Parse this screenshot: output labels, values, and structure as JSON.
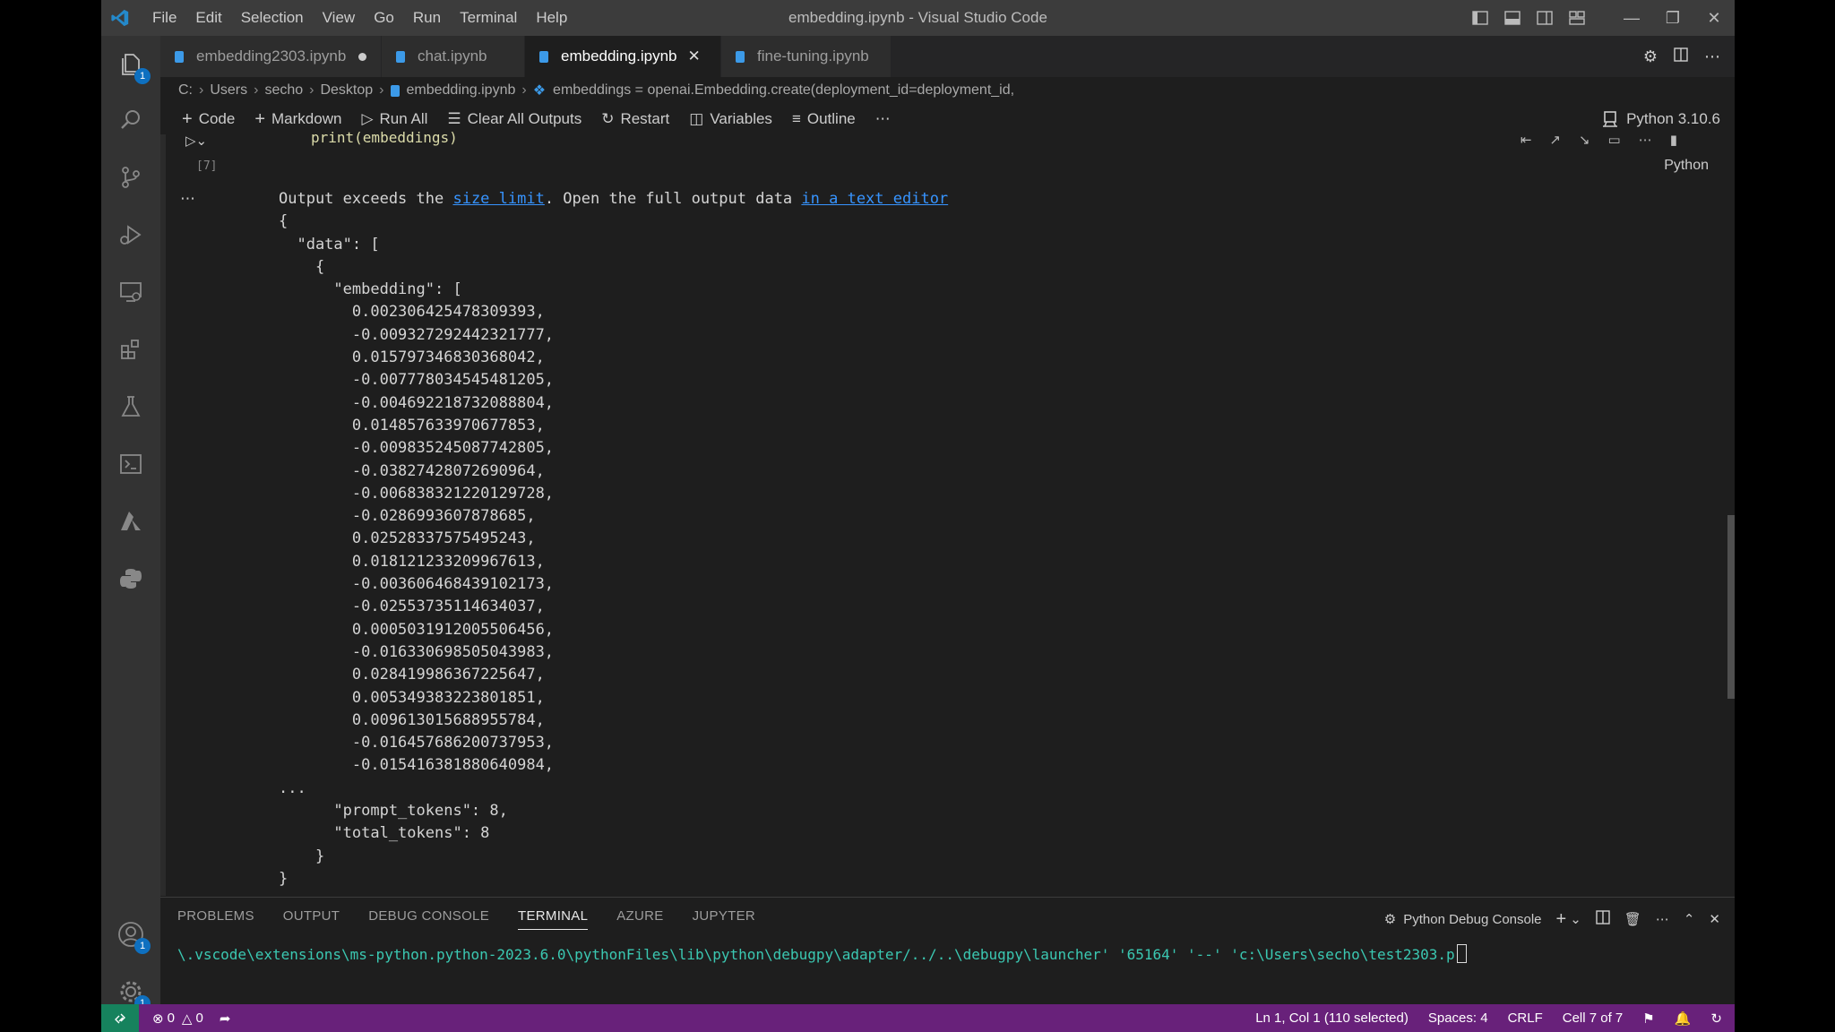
{
  "window": {
    "title": "embedding.ipynb - Visual Studio Code",
    "menu": [
      "File",
      "Edit",
      "Selection",
      "View",
      "Go",
      "Run",
      "Terminal",
      "Help"
    ]
  },
  "activity": {
    "explorer_badge": "1",
    "accounts_badge": "1",
    "manage_badge": "1"
  },
  "tabs": [
    {
      "label": "embedding2303.ipynb",
      "modified": true
    },
    {
      "label": "chat.ipynb"
    },
    {
      "label": "embedding.ipynb",
      "active": true
    },
    {
      "label": "fine-tuning.ipynb"
    }
  ],
  "breadcrumb": {
    "items": [
      "C:",
      "Users",
      "secho",
      "Desktop",
      "embedding.ipynb",
      "embeddings = openai.Embedding.create(deployment_id=deployment_id,"
    ]
  },
  "notebook_toolbar": {
    "code": "Code",
    "markdown": "Markdown",
    "run_all": "Run All",
    "clear_all_outputs": "Clear All Outputs",
    "restart": "Restart",
    "variables": "Variables",
    "outline": "Outline",
    "kernel": "Python 3.10.6"
  },
  "cell": {
    "code": "print(embeddings)",
    "exec_count": "[7]",
    "language": "Python",
    "output": {
      "prefix": "Output exceeds the ",
      "link1": "size limit",
      "middle": ". Open the full output data ",
      "link2": "in a text editor",
      "body": "{\n  \"data\": [\n    {\n      \"embedding\": [\n        0.002306425478309393,\n        -0.009327292442321777,\n        0.015797346830368042,\n        -0.007778034545481205,\n        -0.004692218732088804,\n        0.014857633970677853,\n        -0.009835245087742805,\n        -0.03827428072690964,\n        -0.006838321220129728,\n        -0.0286993607878685,\n        0.02528337575495243,\n        0.018121233209967613,\n        -0.003606468439102173,\n        -0.02553735114634037,\n        0.0005031912005506456,\n        -0.016330698505043983,\n        0.028419986367225647,\n        0.005349383223801851,\n        0.009613015688955784,\n        -0.016457686200737953,\n        -0.015416381880640984,\n...\n      \"prompt_tokens\": 8,\n      \"total_tokens\": 8\n    }\n}"
    }
  },
  "panel": {
    "tabs": [
      "PROBLEMS",
      "OUTPUT",
      "DEBUG CONSOLE",
      "TERMINAL",
      "AZURE",
      "JUPYTER"
    ],
    "active_tab": "TERMINAL",
    "terminal_name": "Python Debug Console",
    "terminal_line": "\\.vscode\\extensions\\ms-python.python-2023.6.0\\pythonFiles\\lib\\python\\debugpy\\adapter/../..\\debugpy\\launcher' '65164' '--' 'c:\\Users\\secho\\test2303.p"
  },
  "statusbar": {
    "errors": "0",
    "warnings": "0",
    "position": "Ln 1, Col 1 (110 selected)",
    "spaces": "Spaces: 4",
    "eol": "CRLF",
    "cell": "Cell 7 of 7"
  },
  "colors": {
    "titlebar": "#3c3c3c",
    "activity_bar": "#333333",
    "editor_bg": "#1e1e1e",
    "statusbar": "#68217a",
    "remote": "#16825d",
    "link": "#3794ff",
    "terminal_text": "#3bc8b2"
  }
}
